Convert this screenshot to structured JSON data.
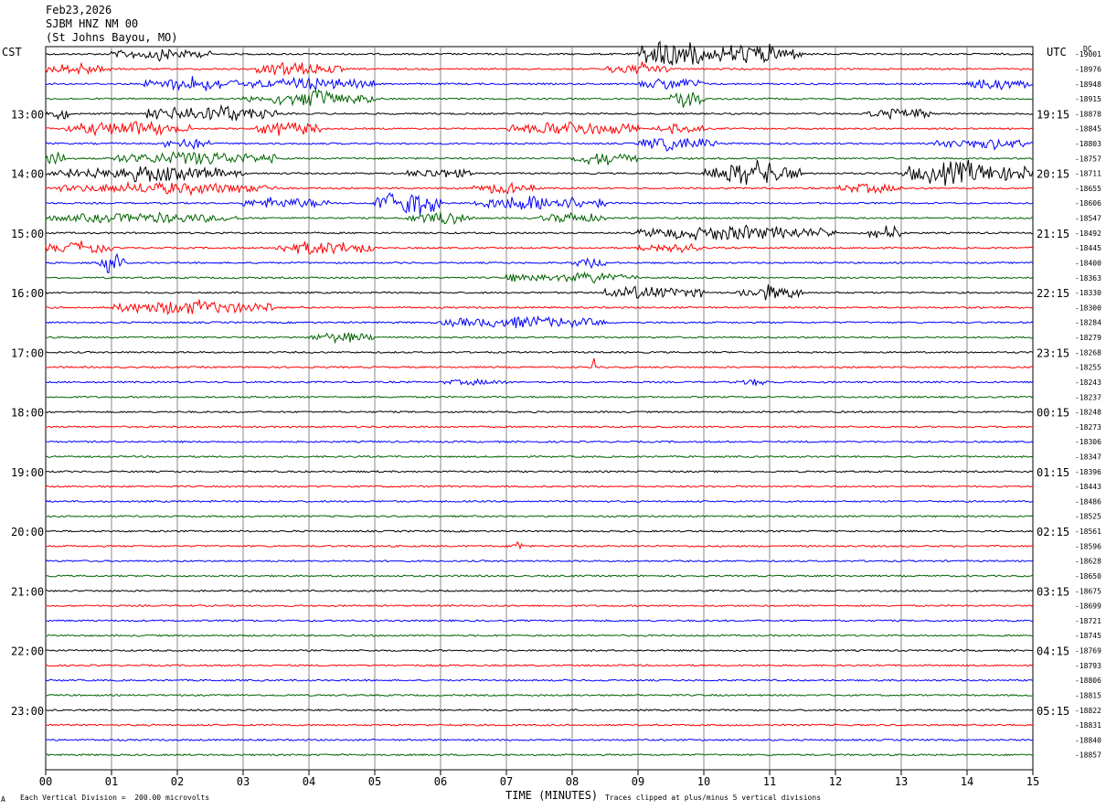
{
  "header": {
    "date": "Feb23,2026",
    "station": "SJBM HNZ NM 00",
    "location": "(St Johns Bayou, MO)"
  },
  "labels": {
    "left_tz": "CST",
    "right_tz": "UTC",
    "xlabel": "TIME (MINUTES)",
    "scale_note": "Each Vertical Division =  200.00 microvolts",
    "clip_note": "Traces clipped at plus/minus 5 vertical divisions",
    "corner_mark": "DC",
    "bottom_left_mark": "A"
  },
  "colors": {
    "trace_cycle": [
      "#000000",
      "#ff0000",
      "#0000ff",
      "#006400"
    ],
    "grid": "#888888"
  },
  "chart_data": {
    "type": "line",
    "title": "SJBM HNZ NM 00 (St Johns Bayou, MO) Feb23,2026",
    "xlabel": "TIME (MINUTES)",
    "xlim": [
      0,
      15
    ],
    "x_ticks": [
      "00",
      "01",
      "02",
      "03",
      "04",
      "05",
      "06",
      "07",
      "08",
      "09",
      "10",
      "11",
      "12",
      "13",
      "14",
      "15"
    ],
    "rows_per_hour": 4,
    "minutes_per_row": 15,
    "left_hour_labels": [
      "13:00",
      "14:00",
      "15:00",
      "16:00",
      "17:00",
      "18:00",
      "19:00",
      "20:00",
      "21:00",
      "22:00",
      "23:00"
    ],
    "right_hour_labels": [
      "19:15",
      "20:15",
      "21:15",
      "22:15",
      "23:15",
      "00:15",
      "01:15",
      "02:15",
      "03:15",
      "04:15",
      "05:15"
    ],
    "row_dc_offsets": [
      -19001,
      -18976,
      -18948,
      -18915,
      -18878,
      -18845,
      -18803,
      -18757,
      -18711,
      -18655,
      -18606,
      -18547,
      -18492,
      -18445,
      -18400,
      -18363,
      -18330,
      -18300,
      -18284,
      -18279,
      -18268,
      -18255,
      -18243,
      -18237,
      -18248,
      -18273,
      -18306,
      -18347,
      -18396,
      -18443,
      -18486,
      -18525,
      -18561,
      -18596,
      -18628,
      -18650,
      -18675,
      -18699,
      -18721,
      -18745,
      -18769,
      -18793,
      -18806,
      -18815,
      -18822,
      -18831,
      -18840,
      -18857
    ],
    "row_activity": [
      [
        [
          1,
          2.5,
          1.2
        ],
        [
          9,
          10,
          3.5
        ],
        [
          10,
          11.5,
          2.2
        ]
      ],
      [
        [
          0,
          1,
          1.2
        ],
        [
          3.2,
          4.5,
          1.5
        ],
        [
          8.5,
          9.5,
          1.2
        ]
      ],
      [
        [
          1.5,
          3,
          1.5
        ],
        [
          3,
          5,
          1.2
        ],
        [
          9,
          10,
          1.2
        ],
        [
          14,
          15,
          1.0
        ]
      ],
      [
        [
          3,
          5,
          1.5
        ],
        [
          9.5,
          10,
          1.8
        ]
      ],
      [
        [
          0,
          0.4,
          1.2
        ],
        [
          1.5,
          3.5,
          1.8
        ],
        [
          12.5,
          13.5,
          1.2
        ]
      ],
      [
        [
          0.3,
          2.2,
          1.5
        ],
        [
          3.2,
          4.2,
          1.5
        ],
        [
          7,
          9,
          1.5
        ],
        [
          9.2,
          10,
          1.0
        ]
      ],
      [
        [
          1.8,
          2.5,
          1.2
        ],
        [
          9,
          10.2,
          1.5
        ],
        [
          13.5,
          15,
          1.2
        ]
      ],
      [
        [
          0,
          0.3,
          1.5
        ],
        [
          1,
          3.5,
          1.5
        ],
        [
          8,
          9,
          1.2
        ]
      ],
      [
        [
          0,
          3,
          1.5
        ],
        [
          5.5,
          6.5,
          1.0
        ],
        [
          10,
          11.5,
          2.5
        ],
        [
          13,
          15,
          2.5
        ]
      ],
      [
        [
          0.2,
          3.5,
          1.2
        ],
        [
          6.5,
          7.5,
          1.0
        ],
        [
          12,
          13,
          1.0
        ]
      ],
      [
        [
          3,
          4.3,
          1.2
        ],
        [
          5,
          6,
          3.0
        ],
        [
          6.5,
          8.5,
          1.8
        ]
      ],
      [
        [
          0,
          3,
          1.0
        ],
        [
          5.5,
          6.5,
          1.2
        ],
        [
          7.5,
          8.5,
          1.0
        ]
      ],
      [
        [
          9,
          12,
          1.5
        ],
        [
          12.5,
          13,
          1.5
        ]
      ],
      [
        [
          0,
          1,
          1.2
        ],
        [
          3.5,
          5,
          1.5
        ],
        [
          9,
          10,
          1.0
        ]
      ],
      [
        [
          0.8,
          1.2,
          2.0
        ],
        [
          8,
          8.5,
          1.0
        ]
      ],
      [
        [
          7,
          7.5,
          1.2
        ],
        [
          7.5,
          9,
          1.0
        ]
      ],
      [
        [
          8.5,
          10,
          1.5
        ],
        [
          10.5,
          11.5,
          1.5
        ]
      ],
      [
        [
          1,
          3.5,
          1.5
        ]
      ],
      [
        [
          6,
          8.5,
          1.2
        ]
      ],
      [
        [
          4,
          5,
          1.0
        ]
      ],
      [],
      [
        [
          8.3,
          8.35,
          2.5
        ]
      ],
      [
        [
          6,
          7,
          0.5
        ],
        [
          10.5,
          11,
          0.6
        ]
      ],
      [],
      [],
      [],
      [],
      [],
      [],
      [],
      [],
      [],
      [],
      [
        [
          7.1,
          7.25,
          2.0
        ]
      ],
      [],
      [],
      [],
      [],
      [],
      [],
      [],
      [],
      [],
      [],
      [],
      [],
      [],
      []
    ]
  }
}
